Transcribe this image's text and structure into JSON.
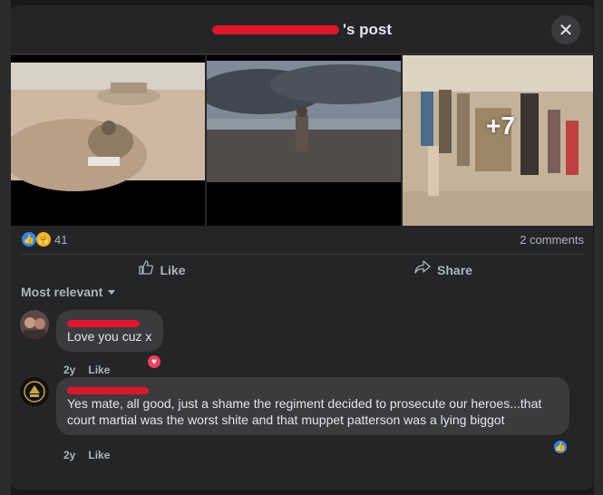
{
  "modal": {
    "title_suffix": "'s post",
    "close_icon": "close-icon"
  },
  "photos": {
    "more_count": "+7"
  },
  "reactions": {
    "count": "41",
    "comments_count": "2 comments",
    "icons": [
      "like-reaction-icon",
      "care-reaction-icon"
    ]
  },
  "actions": {
    "like_label": "Like",
    "share_label": "Share"
  },
  "sort": {
    "label": "Most relevant"
  },
  "comments": [
    {
      "text": "Love you cuz x",
      "age": "2y",
      "like_label": "Like",
      "reaction_icon": "heart-reaction-icon"
    },
    {
      "text": "Yes mate, all good, just a shame the regiment decided to prosecute our heroes...that court martial was the worst shite and that muppet patterson was a lying biggot",
      "age": "2y",
      "like_label": "Like",
      "reaction_icon": "like-reaction-icon"
    }
  ],
  "colors": {
    "background": "#242526",
    "bubble": "#3a3b3c",
    "redaction": "#e0142b",
    "like_blue": "#2d88ff",
    "heart_red": "#f33e58"
  }
}
